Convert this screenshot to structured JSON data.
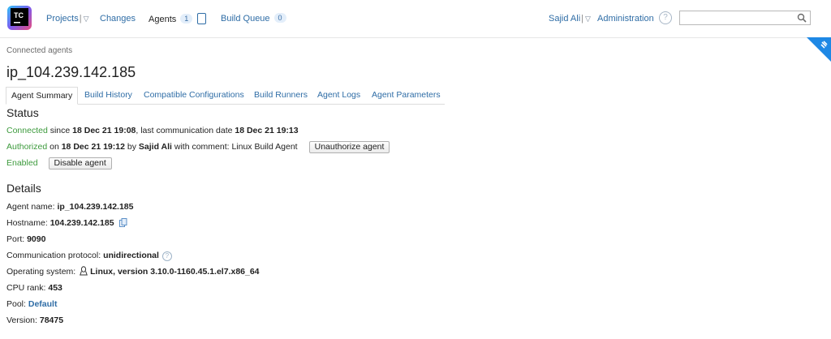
{
  "header": {
    "logo_text": "TC",
    "nav": {
      "projects": "Projects",
      "changes": "Changes",
      "agents": "Agents",
      "agents_count": "1",
      "build_queue": "Build Queue",
      "build_queue_count": "0"
    },
    "user": "Sajid Ali",
    "administration": "Administration",
    "search": {
      "value": "",
      "placeholder": ""
    }
  },
  "breadcrumb": "Connected agents",
  "page_title": "ip_104.239.142.185",
  "tabs": [
    "Agent Summary",
    "Build History",
    "Compatible Configurations",
    "Build Runners",
    "Agent Logs",
    "Agent Parameters"
  ],
  "status": {
    "heading": "Status",
    "connected": {
      "label": "Connected",
      "since_text": " since ",
      "since": "18 Dec 21 19:08",
      "last_text": ", last communication date ",
      "last": "18 Dec 21 19:13"
    },
    "authorized": {
      "label": "Authorized",
      "on_text": " on ",
      "on": "18 Dec 21 19:12",
      "by_text": " by ",
      "by": "Sajid Ali",
      "comment_text": " with comment: Linux Build Agent",
      "button": "Unauthorize agent"
    },
    "enabled": {
      "label": "Enabled",
      "button": "Disable agent"
    }
  },
  "details": {
    "heading": "Details",
    "agent_name": {
      "label": "Agent name: ",
      "value": "ip_104.239.142.185"
    },
    "hostname": {
      "label": "Hostname: ",
      "value": "104.239.142.185"
    },
    "port": {
      "label": "Port: ",
      "value": "9090"
    },
    "protocol": {
      "label": "Communication protocol: ",
      "value": "unidirectional"
    },
    "os": {
      "label": "Operating system: ",
      "value": "Linux, version 3.10.0-1160.45.1.el7.x86_64"
    },
    "cpu": {
      "label": "CPU rank: ",
      "value": "453"
    },
    "pool": {
      "label": "Pool: ",
      "value": "Default"
    },
    "version": {
      "label": "Version: ",
      "value": "78475"
    }
  },
  "colors": {
    "link": "#2f6da6",
    "status_green": "#3c9a3c",
    "corner_badge": "#1e88e5"
  },
  "icons": [
    "teamcity-logo",
    "agents-icon",
    "help-icon",
    "search-icon",
    "copy-icon",
    "question-icon",
    "linux-icon",
    "corner-badge-icon"
  ]
}
